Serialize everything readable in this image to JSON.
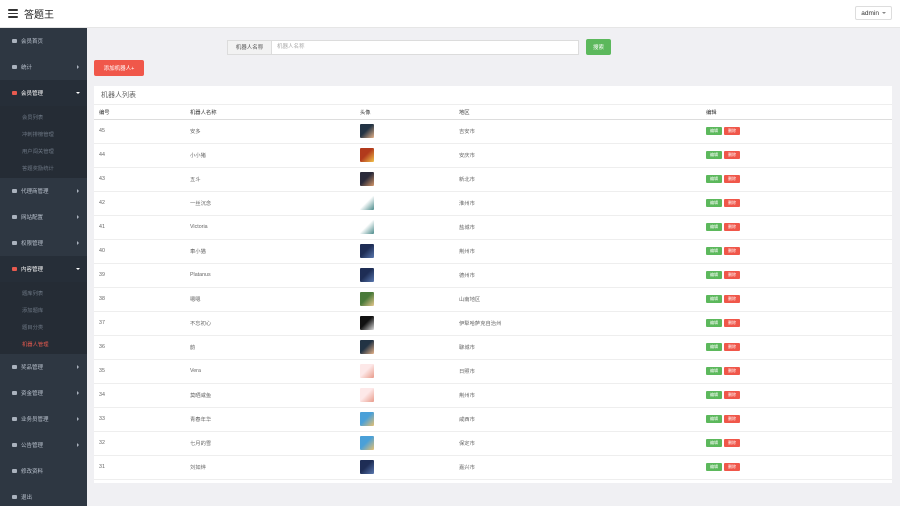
{
  "header": {
    "title": "答题王",
    "user": "admin"
  },
  "colors": {
    "sidebar_bg": "#2e3742",
    "accent_red": "#f0574a",
    "accent_green": "#5cb85c"
  },
  "sidebar": {
    "items": [
      {
        "label": "会员首页",
        "icon": "home-icon",
        "has_arrow": false,
        "open": false,
        "children": []
      },
      {
        "label": "统计",
        "icon": "chart-icon",
        "has_arrow": true,
        "open": false,
        "children": []
      },
      {
        "label": "会员管理",
        "icon": "user-icon",
        "has_arrow": true,
        "open": true,
        "children": [
          {
            "label": "会员列表",
            "active": false
          },
          {
            "label": "冲刺排榜管理",
            "active": false
          },
          {
            "label": "用户闯关管理",
            "active": false
          },
          {
            "label": "答题奖励统计",
            "active": false
          }
        ]
      },
      {
        "label": "代理商管理",
        "icon": "group-icon",
        "has_arrow": true,
        "open": false,
        "children": []
      },
      {
        "label": "网站配置",
        "icon": "gear-icon",
        "has_arrow": true,
        "open": false,
        "children": []
      },
      {
        "label": "权限管理",
        "icon": "gears-icon",
        "has_arrow": true,
        "open": false,
        "children": []
      },
      {
        "label": "内容管理",
        "icon": "book-icon",
        "has_arrow": true,
        "open": true,
        "children": [
          {
            "label": "题库列表",
            "active": false
          },
          {
            "label": "添加题库",
            "active": false
          },
          {
            "label": "题目分类",
            "active": false
          },
          {
            "label": "机器人管理",
            "active": true
          }
        ]
      },
      {
        "label": "奖品管理",
        "icon": "tag-icon",
        "has_arrow": true,
        "open": false,
        "children": []
      },
      {
        "label": "资金管理",
        "icon": "money-icon",
        "has_arrow": true,
        "open": false,
        "children": []
      },
      {
        "label": "业务员管理",
        "icon": "staff-icon",
        "has_arrow": true,
        "open": false,
        "children": []
      },
      {
        "label": "公告管理",
        "icon": "speaker-icon",
        "has_arrow": true,
        "open": false,
        "children": []
      },
      {
        "label": "修改资料",
        "icon": "settings-icon",
        "has_arrow": false,
        "open": false,
        "children": []
      },
      {
        "label": "退出",
        "icon": "logout-icon",
        "has_arrow": false,
        "open": false,
        "children": []
      }
    ]
  },
  "search": {
    "label": "机器人名称",
    "placeholder": "机器人名称",
    "value": "",
    "button": "搜索"
  },
  "add_button": "添加机器人+",
  "panel": {
    "title": "机器人列表"
  },
  "table": {
    "columns": [
      "编号",
      "机器人名称",
      "头像",
      "地区",
      "编辑"
    ],
    "edit_label": "编辑",
    "delete_label": "删除",
    "rows": [
      {
        "id": "45",
        "name": "安多",
        "region": "吉安市",
        "avatar": [
          "#223344",
          "#e8b48a"
        ]
      },
      {
        "id": "44",
        "name": "小小猪",
        "region": "安庆市",
        "avatar": [
          "#b23a1c",
          "#f2c24a"
        ]
      },
      {
        "id": "43",
        "name": "五斗",
        "region": "新北市",
        "avatar": [
          "#2a2a3a",
          "#d89a6a"
        ]
      },
      {
        "id": "42",
        "name": "一丝沉念",
        "region": "淮州市",
        "avatar": [
          "#ffffff",
          "#4a8a8a"
        ]
      },
      {
        "id": "41",
        "name": "Victoria",
        "region": "盐城市",
        "avatar": [
          "#ffffff",
          "#4a8a8a"
        ]
      },
      {
        "id": "40",
        "name": "車小猫",
        "region": "荆州市",
        "avatar": [
          "#1e2d55",
          "#5a78b0"
        ]
      },
      {
        "id": "39",
        "name": "Platanus",
        "region": "德州市",
        "avatar": [
          "#1e2d55",
          "#5a78b0"
        ]
      },
      {
        "id": "38",
        "name": "嗯嗯",
        "region": "山南地区",
        "avatar": [
          "#4a7a3a",
          "#e8c890"
        ]
      },
      {
        "id": "37",
        "name": "不忘初心",
        "region": "伊犁哈萨克自治州",
        "avatar": [
          "#111111",
          "#dddddd"
        ]
      },
      {
        "id": "36",
        "name": "韵",
        "region": "聊城市",
        "avatar": [
          "#223344",
          "#e8b48a"
        ]
      },
      {
        "id": "35",
        "name": "Vera",
        "region": "日照市",
        "avatar": [
          "#fde8e8",
          "#e89a8a"
        ]
      },
      {
        "id": "34",
        "name": "莫晒咸鱼",
        "region": "荆州市",
        "avatar": [
          "#fde8e8",
          "#e89a8a"
        ]
      },
      {
        "id": "33",
        "name": "青春年华",
        "region": "咸西市",
        "avatar": [
          "#4aa0d8",
          "#e8c070"
        ]
      },
      {
        "id": "32",
        "name": "七月的雪",
        "region": "保定市",
        "avatar": [
          "#4aa0d8",
          "#e8c070"
        ]
      },
      {
        "id": "31",
        "name": "刘如烨",
        "region": "嘉兴市",
        "avatar": [
          "#1e2d55",
          "#5a78b0"
        ]
      }
    ]
  }
}
